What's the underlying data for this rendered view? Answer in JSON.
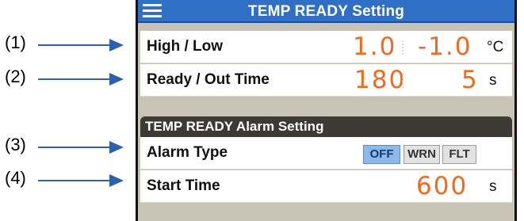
{
  "callouts": [
    "(1)",
    "(2)",
    "(3)",
    "(4)"
  ],
  "header": {
    "title": "TEMP READY Setting"
  },
  "high_low": {
    "label": "High / Low",
    "high": "1.0",
    "low": "-1.0",
    "unit": "°C"
  },
  "ready_out": {
    "label": "Ready / Out Time",
    "ready": "180",
    "out": "5",
    "unit": "s"
  },
  "alarm_section": {
    "title": "TEMP READY Alarm Setting"
  },
  "alarm_type": {
    "label": "Alarm Type",
    "options": [
      "OFF",
      "WRN",
      "FLT"
    ],
    "selected": "OFF"
  },
  "start_time": {
    "label": "Start Time",
    "value": "600",
    "unit": "s"
  },
  "colors": {
    "title_bar": "#2f6fc6",
    "value_orange": "#f06a1d",
    "arrow_blue": "#2d5fb0",
    "panel_bg": "#c9c3b6"
  }
}
